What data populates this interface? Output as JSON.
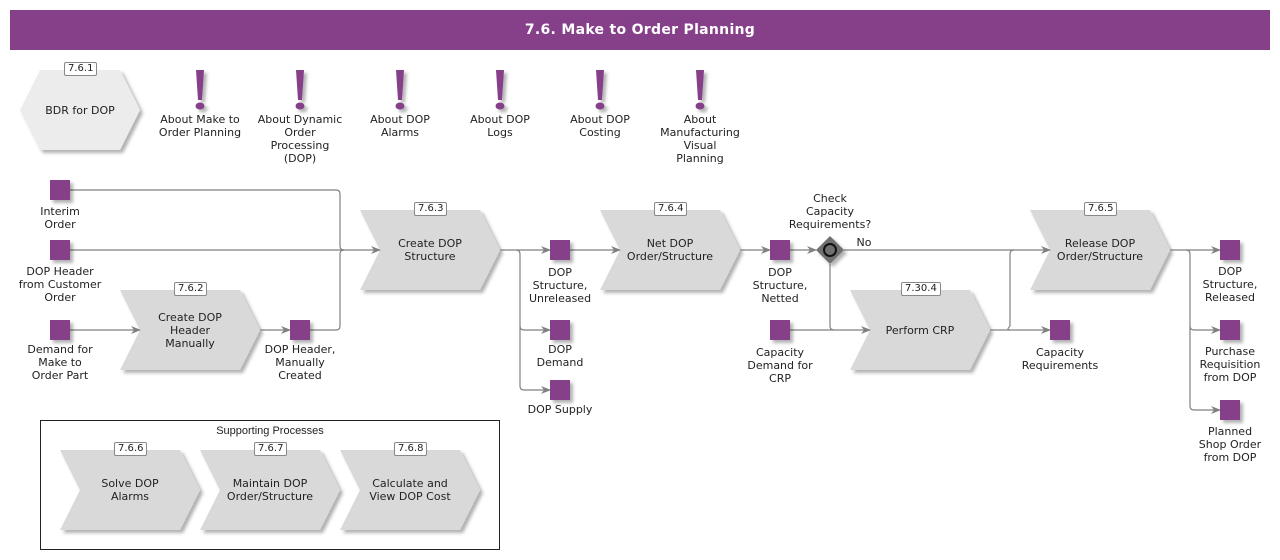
{
  "header": {
    "title": "7.6. Make to Order Planning"
  },
  "colors": {
    "accent": "#86408a",
    "process_fill": "#d9d9d9",
    "gateway": "#707070",
    "line": "#808080"
  },
  "bdr": {
    "id": "7.6.1",
    "label": "BDR for DOP"
  },
  "info_items": [
    {
      "icon": "exclamation-icon",
      "label": "About Make to\nOrder Planning"
    },
    {
      "icon": "exclamation-icon",
      "label": "About Dynamic\nOrder\nProcessing\n(DOP)"
    },
    {
      "icon": "exclamation-icon",
      "label": "About DOP\nAlarms"
    },
    {
      "icon": "exclamation-icon",
      "label": "About DOP\nLogs"
    },
    {
      "icon": "exclamation-icon",
      "label": "About DOP\nCosting"
    },
    {
      "icon": "exclamation-icon",
      "label": "About\nManufacturing\nVisual\nPlanning"
    }
  ],
  "processes": [
    {
      "id": "7.6.2",
      "label": "Create DOP\nHeader\nManually"
    },
    {
      "id": "7.6.3",
      "label": "Create DOP\nStructure"
    },
    {
      "id": "7.6.4",
      "label": "Net DOP\nOrder/Structure"
    },
    {
      "id": "7.30.4",
      "label": "Perform CRP"
    },
    {
      "id": "7.6.5",
      "label": "Release DOP\nOrder/Structure"
    }
  ],
  "data_objects": [
    {
      "label": "Interim\nOrder"
    },
    {
      "label": "DOP Header\nfrom Customer\nOrder"
    },
    {
      "label": "Demand for\nMake to\nOrder Part"
    },
    {
      "label": "DOP Header,\nManually\nCreated"
    },
    {
      "label": "DOP\nStructure,\nUnreleased"
    },
    {
      "label": "DOP\nDemand"
    },
    {
      "label": "DOP Supply"
    },
    {
      "label": "DOP\nStructure,\nNetted"
    },
    {
      "label": "Capacity\nDemand for\nCRP"
    },
    {
      "label": "Capacity\nRequirements"
    },
    {
      "label": "DOP\nStructure,\nReleased"
    },
    {
      "label": "Purchase\nRequisition\nfrom DOP"
    },
    {
      "label": "Planned\nShop Order\nfrom DOP"
    }
  ],
  "gateway": {
    "label": "Check\nCapacity\nRequirements?",
    "branch_label": "No"
  },
  "supporting": {
    "title": "Supporting Processes",
    "items": [
      {
        "id": "7.6.6",
        "label": "Solve DOP\nAlarms"
      },
      {
        "id": "7.6.7",
        "label": "Maintain DOP\nOrder/Structure"
      },
      {
        "id": "7.6.8",
        "label": "Calculate and\nView DOP Cost"
      }
    ]
  }
}
